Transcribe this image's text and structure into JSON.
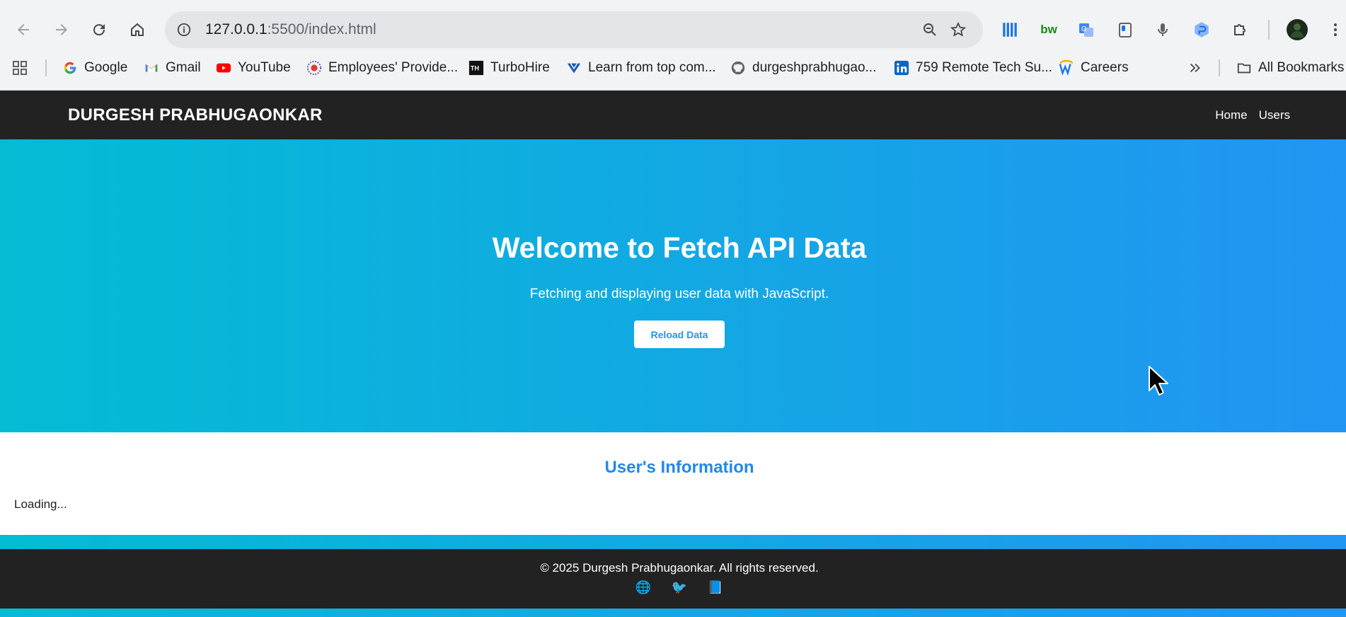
{
  "browser": {
    "url_host": "127.0.0.1",
    "url_path": ":5500/index.html",
    "bookmarks": [
      {
        "label": "Google",
        "icon": "google-icon"
      },
      {
        "label": "Gmail",
        "icon": "gmail-icon"
      },
      {
        "label": "YouTube",
        "icon": "youtube-icon"
      },
      {
        "label": "Employees' Provide...",
        "icon": "epfo-icon"
      },
      {
        "label": "TurboHire",
        "icon": "turbohire-icon"
      },
      {
        "label": "Learn from top com...",
        "icon": "learn-icon"
      },
      {
        "label": "durgeshprabhugao...",
        "icon": "github-icon"
      },
      {
        "label": "759 Remote Tech Su...",
        "icon": "linkedin-icon"
      },
      {
        "label": "Careers",
        "icon": "careers-icon"
      }
    ],
    "all_bookmarks_label": "All Bookmarks"
  },
  "header": {
    "brand": "DURGESH PRABHUGAONKAR",
    "nav": [
      "Home",
      "Users"
    ]
  },
  "hero": {
    "title": "Welcome to Fetch API Data",
    "subtitle": "Fetching and displaying user data with JavaScript.",
    "button_label": "Reload Data"
  },
  "users": {
    "title": "User's Information",
    "status": "Loading..."
  },
  "footer": {
    "copyright": "© 2025 Durgesh Prabhugaonkar. All rights reserved.",
    "icons": [
      "🌐",
      "🐦",
      "📘"
    ]
  },
  "colors": {
    "header_bg": "#222222",
    "gradient_start": "#03bcd4",
    "gradient_end": "#2195f2",
    "accent_blue": "#2196f3"
  }
}
